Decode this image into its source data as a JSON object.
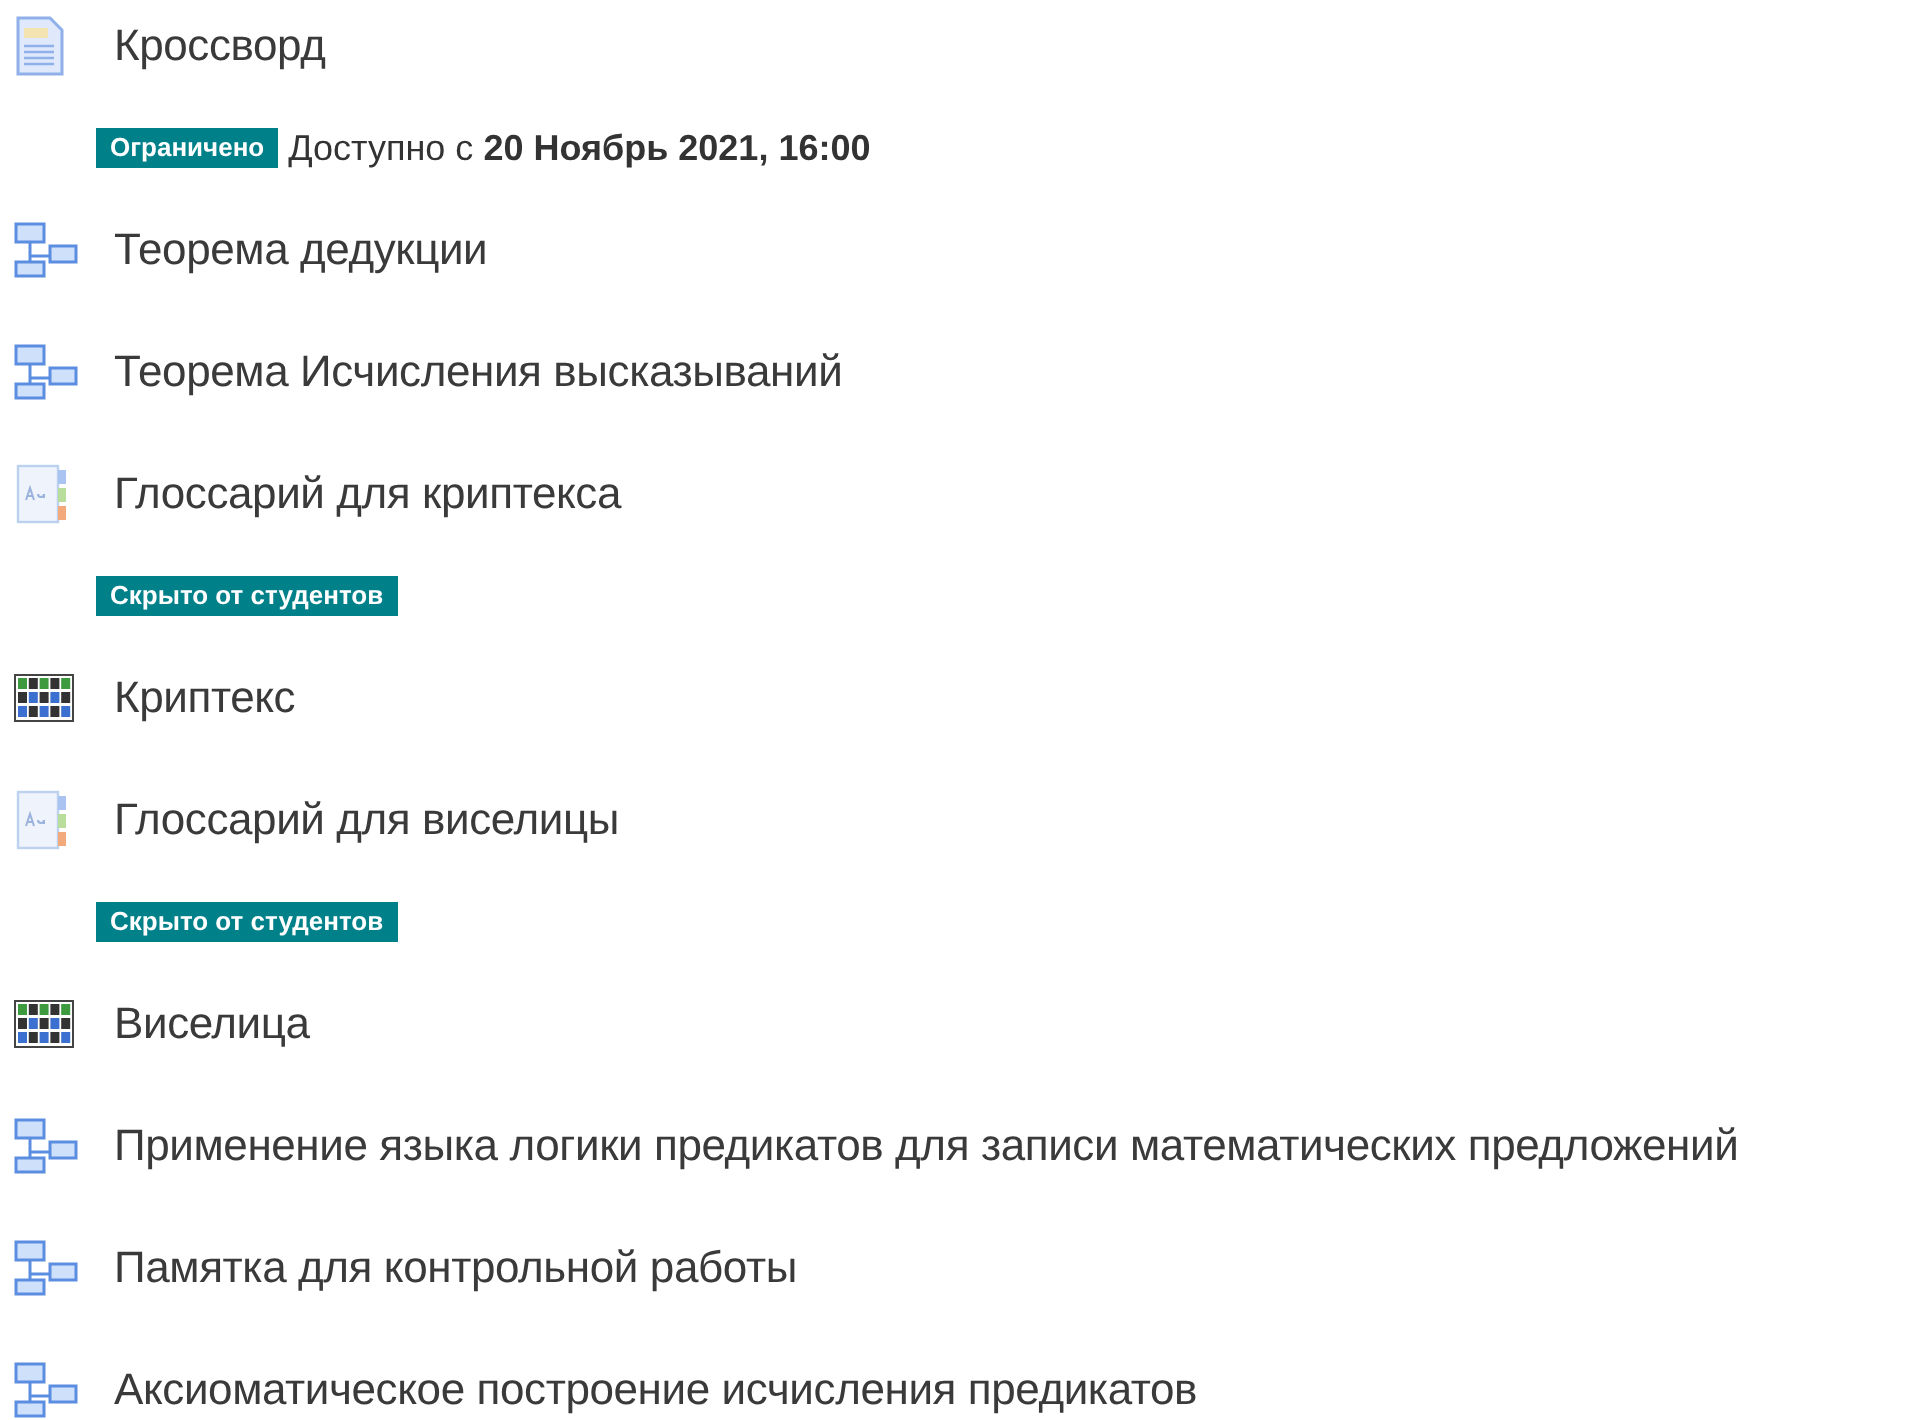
{
  "activities": [
    {
      "kind": "page",
      "title": "Кроссворд",
      "badge": "Ограничено",
      "note": "Доступно с **20 Ноябрь 2021, 16:00**"
    },
    {
      "kind": "book",
      "title": "Теорема дедукции"
    },
    {
      "kind": "book",
      "title": "Теорема Исчисления высказываний"
    },
    {
      "kind": "glossary",
      "title": "Глоссарий для криптекса",
      "badge": "Скрыто от студентов"
    },
    {
      "kind": "game",
      "title": "Криптекс"
    },
    {
      "kind": "glossary",
      "title": "Глоссарий для виселицы",
      "badge": "Скрыто от студентов"
    },
    {
      "kind": "game",
      "title": "Виселица"
    },
    {
      "kind": "book",
      "title": "Применение языка логики предикатов для записи математических предложений"
    },
    {
      "kind": "book",
      "title": "Памятка для контрольной работы"
    },
    {
      "kind": "book",
      "title": "Аксиоматическое построение исчисления предикатов"
    }
  ]
}
